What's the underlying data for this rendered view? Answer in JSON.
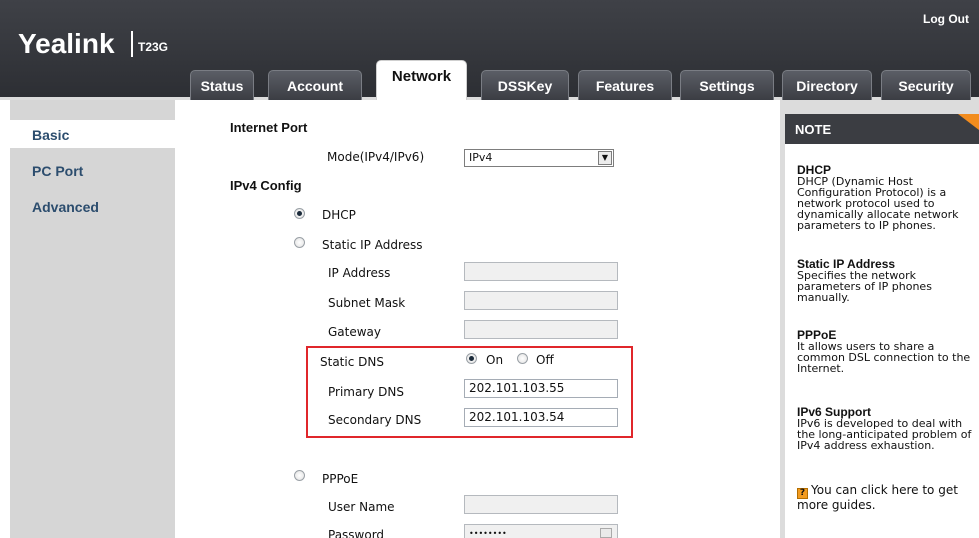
{
  "header": {
    "brand": "Yealink",
    "model": "T23G",
    "logout_label": "Log Out"
  },
  "tabs": [
    {
      "label": "Status"
    },
    {
      "label": "Account"
    },
    {
      "label": "Network",
      "active": true
    },
    {
      "label": "DSSKey"
    },
    {
      "label": "Features"
    },
    {
      "label": "Settings"
    },
    {
      "label": "Directory"
    },
    {
      "label": "Security"
    }
  ],
  "sidebar": {
    "items": [
      {
        "label": "Basic",
        "selected": true
      },
      {
        "label": "PC Port"
      },
      {
        "label": "Advanced"
      }
    ]
  },
  "form": {
    "internet_port_title": "Internet Port",
    "mode_label": "Mode(IPv4/IPv6)",
    "mode_value": "IPv4",
    "ipv4_config_title": "IPv4 Config",
    "dhcp_label": "DHCP",
    "static_ip_label": "Static IP Address",
    "ip_address_label": "IP Address",
    "subnet_mask_label": "Subnet Mask",
    "gateway_label": "Gateway",
    "static_dns_label": "Static DNS",
    "static_dns_on_label": "On",
    "static_dns_off_label": "Off",
    "primary_dns_label": "Primary DNS",
    "primary_dns_value": "202.101.103.55",
    "secondary_dns_label": "Secondary DNS",
    "secondary_dns_value": "202.101.103.54",
    "pppoe_label": "PPPoE",
    "user_name_label": "User Name",
    "password_label": "Password",
    "password_value": "••••••••"
  },
  "note": {
    "title": "NOTE",
    "dhcp_title": "DHCP",
    "dhcp_text": "DHCP (Dynamic Host Configuration Protocol) is a network protocol used to dynamically allocate network parameters to IP phones.",
    "static_title": "Static IP Address",
    "static_text": "Specifies the network parameters of IP phones manually.",
    "pppoe_title": "PPPoE",
    "pppoe_text": "It allows users to share a common DSL connection to the Internet.",
    "ipv6_title": "IPv6 Support",
    "ipv6_text": "IPv6 is developed to deal with the long-anticipated problem of IPv4 address exhaustion.",
    "guide_icon_glyph": "?",
    "guide_text": "You can click here to get more guides."
  },
  "colors": {
    "header": "#2c2e33",
    "accent_orange": "#f28c1e",
    "highlight_red": "#e0262b",
    "nav_text": "#2c4d6e"
  }
}
